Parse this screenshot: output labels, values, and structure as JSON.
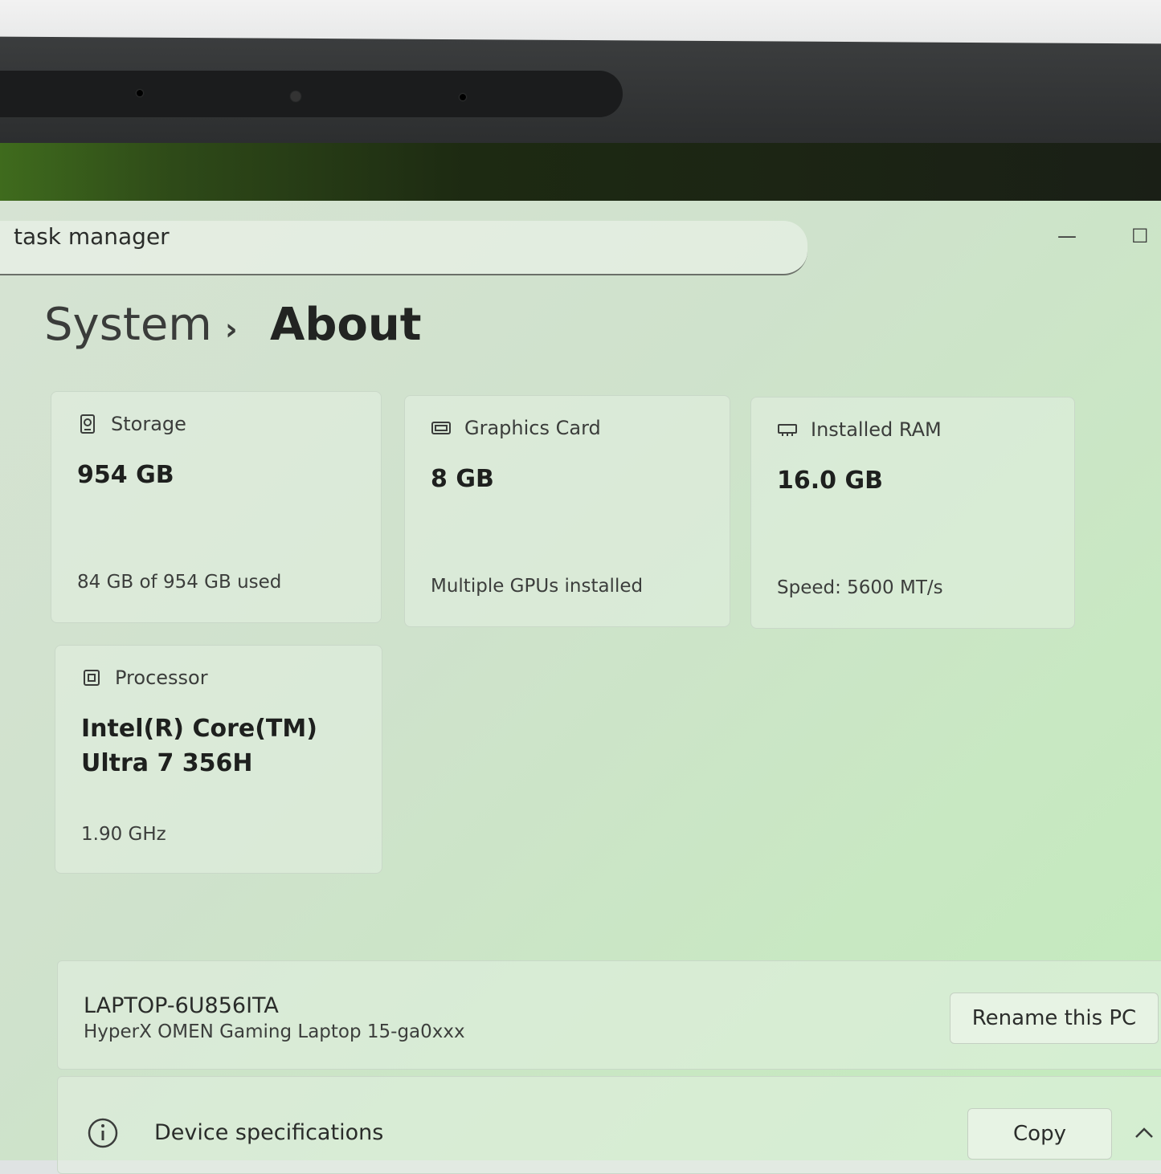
{
  "search": {
    "value": "task manager"
  },
  "window_controls": {
    "minimize": "—",
    "maximize": "☐"
  },
  "breadcrumb": {
    "parent": "System",
    "separator": "›",
    "current": "About"
  },
  "cards": {
    "storage": {
      "title": "Storage",
      "value": "954 GB",
      "sub": "84 GB of 954 GB used",
      "icon": "storage-icon"
    },
    "graphics": {
      "title": "Graphics Card",
      "value": "8 GB",
      "sub": "Multiple GPUs installed",
      "icon": "gpu-icon"
    },
    "ram": {
      "title": "Installed RAM",
      "value": "16.0 GB",
      "sub": "Speed: 5600 MT/s",
      "icon": "ram-icon"
    },
    "processor": {
      "title": "Processor",
      "value": "Intel(R) Core(TM) Ultra 7 356H",
      "sub": "1.90 GHz",
      "icon": "cpu-icon"
    }
  },
  "pc": {
    "name": "LAPTOP-6U856ITA",
    "model": "HyperX OMEN Gaming Laptop 15-ga0xxx",
    "rename_label": "Rename this PC"
  },
  "device_specs": {
    "label": "Device specifications",
    "copy_label": "Copy",
    "icon": "info-icon",
    "toggle_icon": "chevron-up-icon"
  }
}
